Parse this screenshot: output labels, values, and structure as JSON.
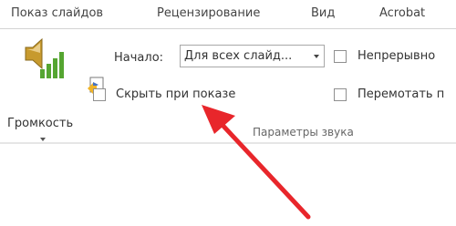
{
  "tabs": [
    "Показ слайдов",
    "Рецензирование",
    "Вид",
    "Acrobat"
  ],
  "volume": {
    "label": "Громкость",
    "icon": "speaker-volume-icon"
  },
  "start": {
    "label": "Начало:",
    "value": "Для всех слайд...",
    "icon": "animation-start-icon"
  },
  "options": {
    "loop": "Непрерывно",
    "hide": "Скрыть при показе",
    "rewind": "Перемотать п"
  },
  "group": {
    "label": "Параметры звука"
  },
  "colors": {
    "annotation_arrow": "#e8262b",
    "speaker_body": "#c79a2e",
    "bars": "#55a531"
  }
}
